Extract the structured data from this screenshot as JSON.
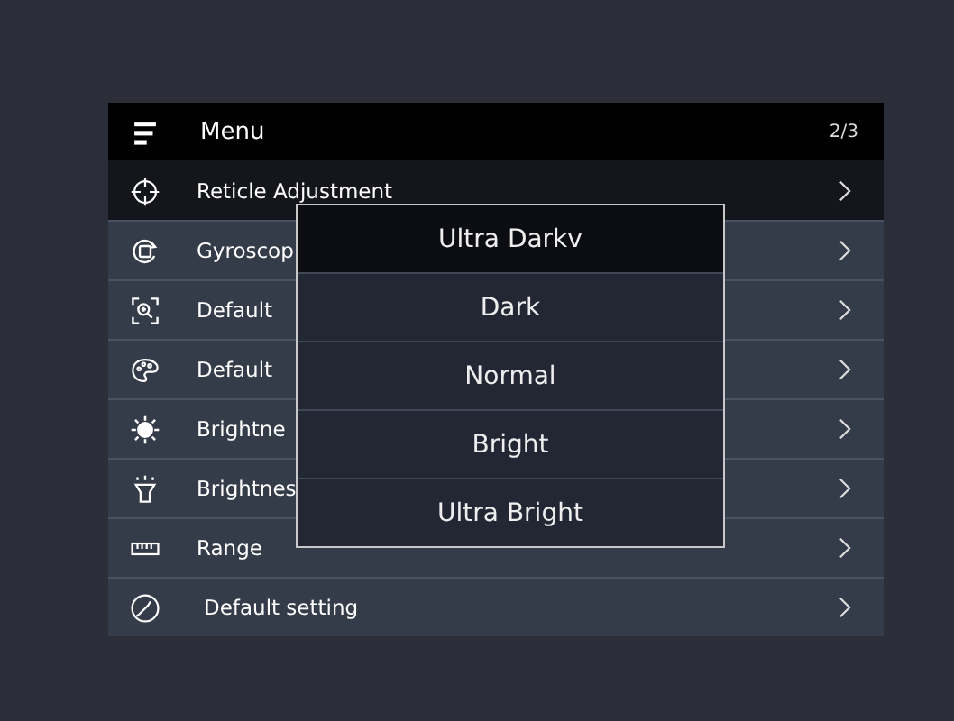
{
  "menu": {
    "title": "Menu",
    "page": "2/3",
    "items": [
      {
        "label": "Reticle Adjustment",
        "selected": true
      },
      {
        "label": "Gyroscop",
        "selected": false
      },
      {
        "label": "Default",
        "selected": false
      },
      {
        "label": "Default",
        "selected": false
      },
      {
        "label": "Brightne",
        "selected": false
      },
      {
        "label": "Brightnes",
        "selected": false
      },
      {
        "label": "Range",
        "selected": false
      },
      {
        "label": "Default setting",
        "selected": false
      }
    ]
  },
  "dropdown": {
    "options": [
      {
        "label": "Ultra Darkv",
        "selected": true
      },
      {
        "label": "Dark",
        "selected": false
      },
      {
        "label": "Normal",
        "selected": false
      },
      {
        "label": "Bright",
        "selected": false
      },
      {
        "label": "Ultra Bright",
        "selected": false
      }
    ]
  }
}
